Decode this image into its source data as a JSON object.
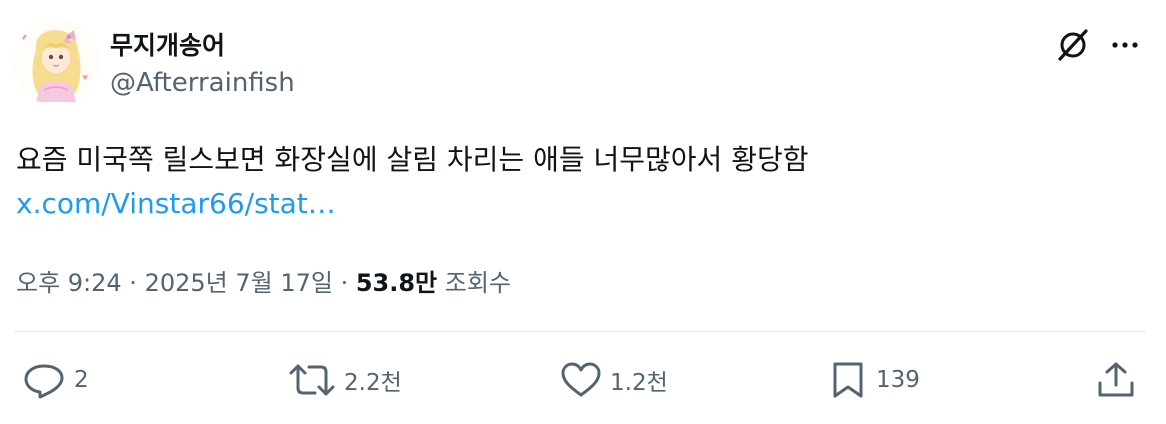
{
  "author": {
    "display_name": "무지개송어",
    "handle": "@Afterrainfish"
  },
  "tweet": {
    "text": "요즘 미국쪽 릴스보면 화장실에 살림 차리는 애들 너무많아서 황당함",
    "link": "x.com/Vinstar66/stat…"
  },
  "meta": {
    "timestamp": "오후 9:24 · 2025년 7월 17일 · ",
    "views_count": "53.8만",
    "views_label": " 조회수"
  },
  "actions": {
    "reply_count": "2",
    "retweet_count": "2.2천",
    "like_count": "1.2천",
    "bookmark_count": "139"
  },
  "colors": {
    "text": "#0f1419",
    "secondary": "#536471",
    "link": "#1d9bf0",
    "divider": "#e7eaed"
  },
  "icons": [
    "grok-icon",
    "more-icon",
    "reply-icon",
    "retweet-icon",
    "like-icon",
    "bookmark-icon",
    "share-icon"
  ]
}
